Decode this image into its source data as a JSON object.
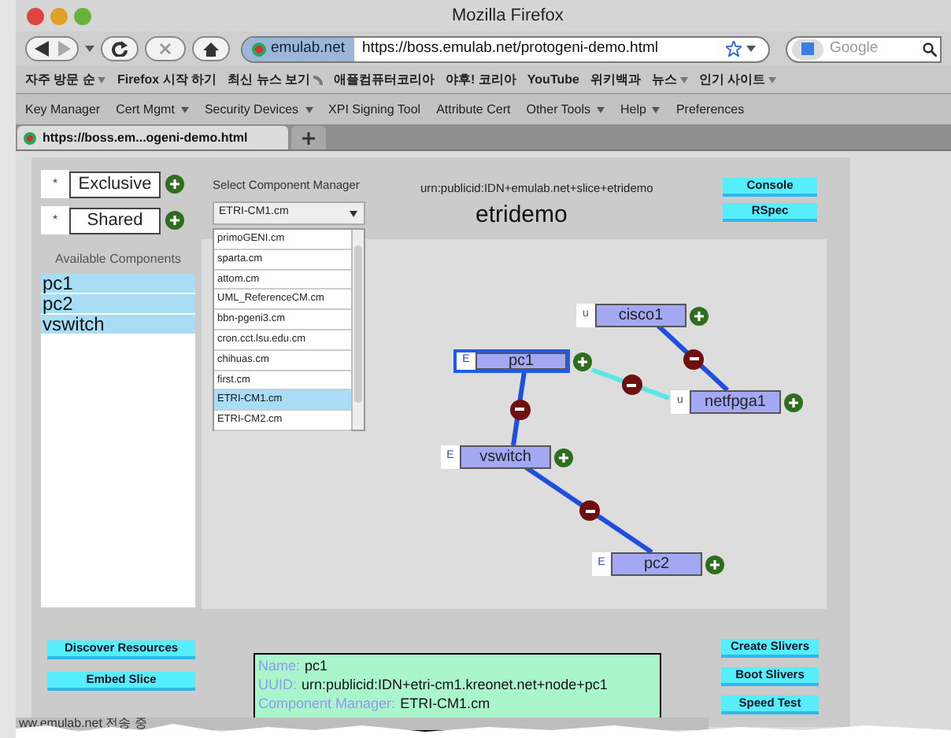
{
  "window": {
    "title": "Mozilla Firefox"
  },
  "url_bar": {
    "site_badge": "emulab.net",
    "url": "https://boss.emulab.net/protogeni-demo.html"
  },
  "search": {
    "placeholder": "Google"
  },
  "bookmarks": [
    {
      "label": "자주 방문 순",
      "menu": true,
      "feed": false
    },
    {
      "label": "Firefox 시작 하기",
      "menu": false,
      "feed": false
    },
    {
      "label": "최신 뉴스 보기",
      "menu": false,
      "feed": true
    },
    {
      "label": "애플컴퓨터코리아",
      "menu": false,
      "feed": false
    },
    {
      "label": "야후! 코리아",
      "menu": false,
      "feed": false
    },
    {
      "label": "YouTube",
      "menu": false,
      "feed": false
    },
    {
      "label": "위키백과",
      "menu": false,
      "feed": false
    },
    {
      "label": "뉴스",
      "menu": true,
      "feed": false
    },
    {
      "label": "인기 사이트",
      "menu": true,
      "feed": false
    }
  ],
  "menu_toolbar": [
    {
      "label": "Key Manager",
      "menu": false
    },
    {
      "label": "Cert Mgmt",
      "menu": true
    },
    {
      "label": "Security Devices",
      "menu": true
    },
    {
      "label": "XPI Signing Tool",
      "menu": false
    },
    {
      "label": "Attribute Cert",
      "menu": false
    },
    {
      "label": "Other Tools",
      "menu": true
    },
    {
      "label": "Help",
      "menu": true
    },
    {
      "label": "Preferences",
      "menu": false
    }
  ],
  "tabs": [
    {
      "label": "https://boss.em...ogeni-demo.html",
      "selected": true
    }
  ],
  "node_types": [
    {
      "marker": "*",
      "label": "Exclusive"
    },
    {
      "marker": "*",
      "label": "Shared"
    }
  ],
  "available_components": {
    "title": "Available Components",
    "items": [
      {
        "label": "pc1",
        "selected": true
      },
      {
        "label": "pc2",
        "selected": true
      },
      {
        "label": "vswitch",
        "selected": true
      }
    ]
  },
  "cm_select": {
    "label": "Select Component Manager",
    "value": "ETRI-CM1.cm",
    "options": [
      {
        "label": "primoGENI.cm",
        "selected": false
      },
      {
        "label": "sparta.cm",
        "selected": false
      },
      {
        "label": "attom.cm",
        "selected": false
      },
      {
        "label": "UML_ReferenceCM.cm",
        "selected": false
      },
      {
        "label": "bbn-pgeni3.cm",
        "selected": false
      },
      {
        "label": "cron.cct.lsu.edu.cm",
        "selected": false
      },
      {
        "label": "chihuas.cm",
        "selected": false
      },
      {
        "label": "first.cm",
        "selected": false
      },
      {
        "label": "ETRI-CM1.cm",
        "selected": true
      },
      {
        "label": "ETRI-CM2.cm",
        "selected": false
      }
    ]
  },
  "slice": {
    "urn": "urn:publicid:IDN+emulab.net+slice+etridemo",
    "name": "etridemo"
  },
  "top_buttons": [
    "Console",
    "RSpec"
  ],
  "graph": {
    "nodes": [
      {
        "type": "u",
        "label": "cisco1",
        "selected": false
      },
      {
        "type": "E",
        "label": "pc1",
        "selected": true
      },
      {
        "type": "u",
        "label": "netfpga1",
        "selected": false
      },
      {
        "type": "E",
        "label": "vswitch",
        "selected": false
      },
      {
        "type": "E",
        "label": "pc2",
        "selected": false
      }
    ],
    "links": [
      {
        "color": "#1f4fe0"
      },
      {
        "color": "#5ae6e6"
      },
      {
        "color": "#1f4fe0"
      },
      {
        "color": "#1f4fe0"
      }
    ]
  },
  "left_buttons": [
    "Discover Resources",
    "Embed Slice"
  ],
  "info": [
    {
      "label": "Name:",
      "value": "pc1"
    },
    {
      "label": "UUID:",
      "value": "urn:publicid:IDN+etri-cm1.kreonet.net+node+pc1"
    },
    {
      "label": "Component Manager:",
      "value": "ETRI-CM1.cm"
    }
  ],
  "right_buttons": [
    "Create Slivers",
    "Boot Slivers",
    "Speed Test"
  ],
  "status_bar": {
    "text": "ww.emulab.net 전송 중"
  }
}
